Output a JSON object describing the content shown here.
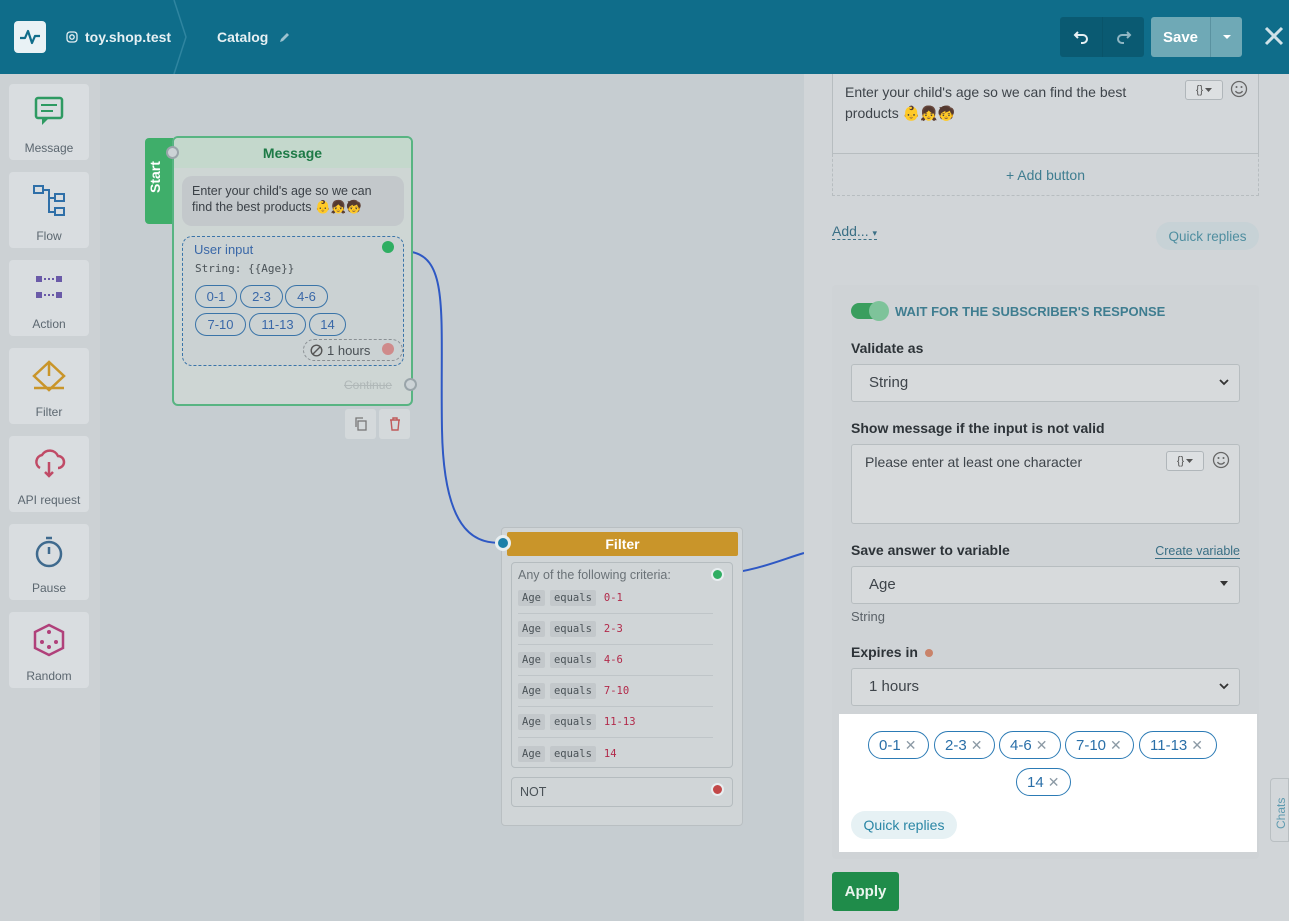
{
  "header": {
    "account": "toy.shop.test",
    "breadcrumb": "Catalog",
    "save_label": "Save"
  },
  "sidebar": {
    "tools": [
      {
        "label": "Message",
        "icon": "message-icon"
      },
      {
        "label": "Flow",
        "icon": "flow-icon"
      },
      {
        "label": "Action",
        "icon": "action-icon"
      },
      {
        "label": "Filter",
        "icon": "filter-icon"
      },
      {
        "label": "API request",
        "icon": "api-request-icon"
      },
      {
        "label": "Pause",
        "icon": "pause-icon"
      },
      {
        "label": "Random",
        "icon": "random-icon"
      }
    ]
  },
  "canvas": {
    "message_node": {
      "start_label": "Start",
      "title": "Message",
      "text": "Enter your child's age so we can find the best products 👶👧🧒",
      "user_input_title": "User input",
      "user_input_type": "String: {{Age}}",
      "chips": [
        "0-1",
        "2-3",
        "4-6",
        "7-10",
        "11-13",
        "14"
      ],
      "timeout": "1 hours",
      "continue_label": "Continue"
    },
    "filter_node": {
      "title": "Filter",
      "criteria_heading": "Any of the following criteria:",
      "criteria": [
        {
          "field": "Age",
          "op": "equals",
          "value": "0-1"
        },
        {
          "field": "Age",
          "op": "equals",
          "value": "2-3"
        },
        {
          "field": "Age",
          "op": "equals",
          "value": "4-6"
        },
        {
          "field": "Age",
          "op": "equals",
          "value": "7-10"
        },
        {
          "field": "Age",
          "op": "equals",
          "value": "11-13"
        },
        {
          "field": "Age",
          "op": "equals",
          "value": "14"
        }
      ],
      "not_label": "NOT"
    }
  },
  "panel": {
    "message_text": "Enter your child's age so we can find the best products 👶👧🧒",
    "add_button": "+ Add button",
    "add_more": "Add...",
    "quick_replies_label": "Quick replies",
    "wait_toggle_label": "WAIT FOR THE SUBSCRIBER'S RESPONSE",
    "validate_label": "Validate as",
    "validate_value": "String",
    "invalid_msg_label": "Show message if the input is not valid",
    "invalid_msg_value": "Please enter at least one character",
    "save_var_label": "Save answer to variable",
    "create_variable": "Create variable",
    "variable_value": "Age",
    "variable_type": "String",
    "expires_label": "Expires in",
    "expires_value": "1 hours",
    "quick_reply_chips": [
      "0-1",
      "2-3",
      "4-6",
      "7-10",
      "11-13",
      "14"
    ],
    "quick_replies_button": "Quick replies",
    "apply_label": "Apply",
    "chats_tab": "Chats"
  }
}
